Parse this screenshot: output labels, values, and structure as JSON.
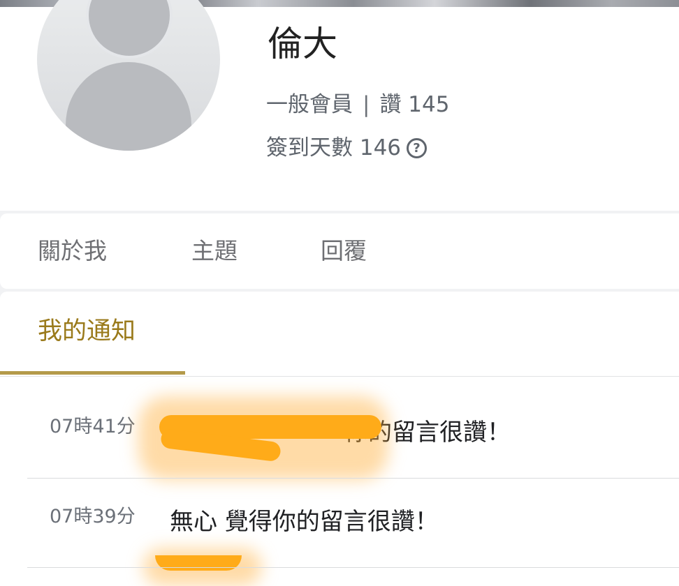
{
  "profile": {
    "name": "倫大",
    "role": "一般會員",
    "separator": "|",
    "likes": "讚 145",
    "checkin": "簽到天數 146",
    "help_icon": "help-circle-icon"
  },
  "tabs": [
    {
      "label": "關於我"
    },
    {
      "label": "主題"
    },
    {
      "label": "回覆"
    }
  ],
  "notifications": {
    "title": "我的通知",
    "accent_color": "#9a7a1b",
    "items": [
      {
        "time": "07時41分",
        "message": "你的留言很讚！",
        "redacted": true
      },
      {
        "time": "07時39分",
        "message": "無心 覺得你的留言很讚！",
        "redacted": false
      }
    ]
  },
  "redaction_color": "#ffab19"
}
